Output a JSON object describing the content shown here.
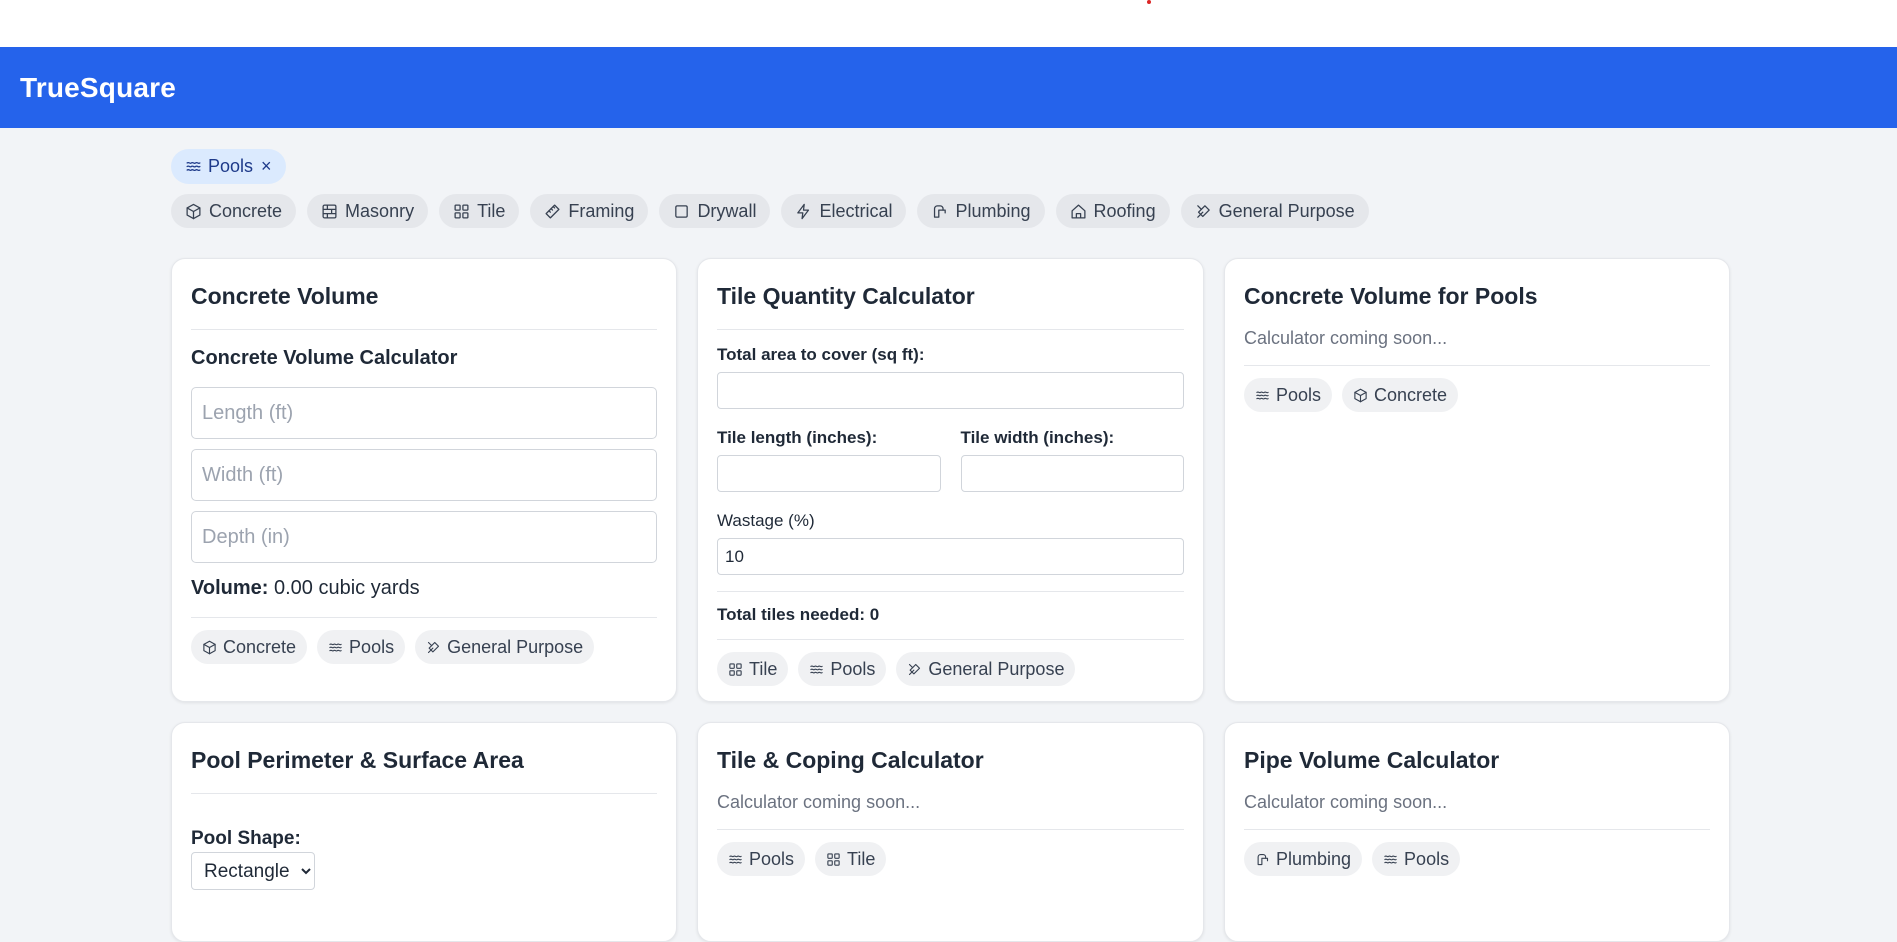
{
  "app": {
    "title": "TrueSquare"
  },
  "active_filter": {
    "label": "Pools",
    "icon": "waves-icon",
    "remove": "×"
  },
  "filters": [
    {
      "label": "Concrete",
      "icon": "box-icon"
    },
    {
      "label": "Masonry",
      "icon": "brick-icon"
    },
    {
      "label": "Tile",
      "icon": "grid-icon"
    },
    {
      "label": "Framing",
      "icon": "ruler-icon"
    },
    {
      "label": "Drywall",
      "icon": "square-icon"
    },
    {
      "label": "Electrical",
      "icon": "zap-icon"
    },
    {
      "label": "Plumbing",
      "icon": "faucet-icon"
    },
    {
      "label": "Roofing",
      "icon": "home-icon"
    },
    {
      "label": "General Purpose",
      "icon": "tools-icon"
    }
  ],
  "cards": {
    "concrete_volume": {
      "title": "Concrete Volume",
      "subtitle": "Concrete Volume Calculator",
      "length_placeholder": "Length (ft)",
      "width_placeholder": "Width (ft)",
      "depth_placeholder": "Depth (in)",
      "result_label": "Volume:",
      "result_value": "0.00 cubic yards",
      "tags": [
        "Concrete",
        "Pools",
        "General Purpose"
      ]
    },
    "tile_quantity": {
      "title": "Tile Quantity Calculator",
      "area_label": "Total area to cover (sq ft):",
      "area_value": "",
      "tile_length_label": "Tile length (inches):",
      "tile_width_label": "Tile width (inches):",
      "wastage_label": "Wastage (%)",
      "wastage_value": "10",
      "total_label": "Total tiles needed: 0",
      "tags": [
        "Tile",
        "Pools",
        "General Purpose"
      ]
    },
    "concrete_pools": {
      "title": "Concrete Volume for Pools",
      "status": "Calculator coming soon...",
      "tags": [
        "Pools",
        "Concrete"
      ]
    },
    "pool_perimeter": {
      "title": "Pool Perimeter & Surface Area",
      "shape_label": "Pool Shape:",
      "shape_value": "Rectangle"
    },
    "tile_coping": {
      "title": "Tile & Coping Calculator",
      "status": "Calculator coming soon...",
      "tags": [
        "Pools",
        "Tile"
      ]
    },
    "pipe_volume": {
      "title": "Pipe Volume Calculator",
      "status": "Calculator coming soon...",
      "tags": [
        "Plumbing",
        "Pools"
      ]
    }
  },
  "colors": {
    "header": "#2563eb",
    "background": "#f2f4f7",
    "active_chip": "#dbeafe"
  }
}
